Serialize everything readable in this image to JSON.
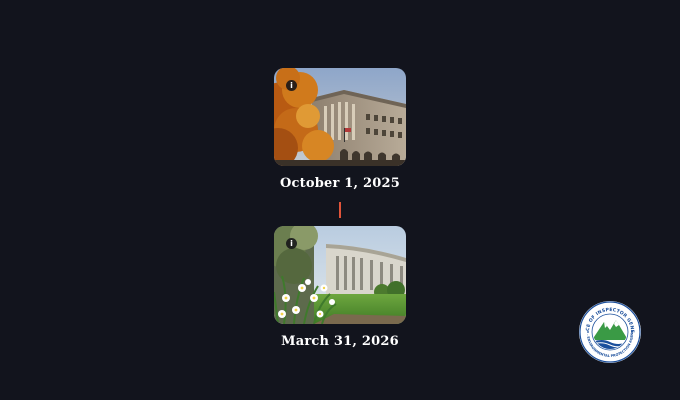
{
  "timeline": {
    "items": [
      {
        "date": "October 1, 2025",
        "image": "EPA headquarters building with autumn foliage",
        "info_icon": "info-icon"
      },
      {
        "date": "March 31, 2026",
        "image": "EPA headquarters building with spring daffodils",
        "info_icon": "info-icon"
      }
    ]
  },
  "seal": {
    "top_text": "OFFICE OF INSPECTOR GENERAL",
    "bottom_text": "U.S. ENVIRONMENTAL PROTECTION AGENCY"
  },
  "colors": {
    "background": "#12141d",
    "connector": "#e0543a",
    "date_text": "#ffffff",
    "seal_blue": "#1b4f9c",
    "seal_green": "#3a9a45"
  }
}
